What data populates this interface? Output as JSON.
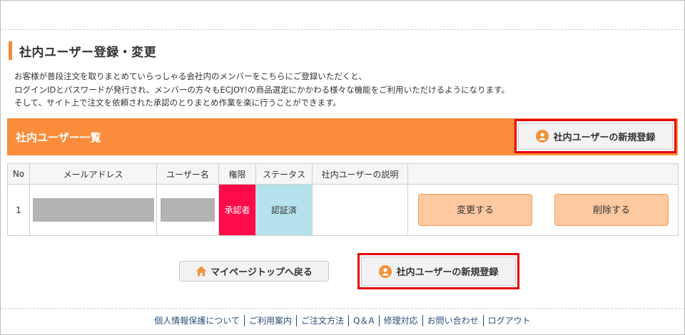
{
  "page": {
    "title": "社内ユーザー登録・変更",
    "intro": [
      "お客様が普段注文を取りまとめていらっしゃる会社内のメンバーをこちらにご登録いただくと、",
      "ログインIDとパスワードが発行され、メンバーの方々もECJOY!の商品選定にかかわる様々な機能をご利用いただけるようになります。",
      "そして、サイト上で注文を依頼された承認のとりまとめ作業を楽に行うことができます。"
    ]
  },
  "user_list": {
    "title": "社内ユーザー一覧",
    "new_button_label": "社内ユーザーの新規登録",
    "columns": {
      "no": "No",
      "email": "メールアドレス",
      "username": "ユーザー名",
      "permission": "権限",
      "status": "ステータス",
      "description": "社内ユーザーの説明"
    },
    "rows": [
      {
        "no": "1",
        "email": "",
        "username": "",
        "permission": "承認者",
        "status": "認証済",
        "description": "",
        "edit_label": "変更する",
        "delete_label": "削除する"
      }
    ]
  },
  "bottom": {
    "back_label": "マイページトップへ戻る",
    "new_button_label": "社内ユーザーの新規登録"
  },
  "footer": {
    "links": [
      "個人情報保護について",
      "ご利用案内",
      "ご注文方法",
      "Q＆A",
      "修理対応",
      "お問い合わせ",
      "ログアウト"
    ]
  },
  "colors": {
    "accent_orange": "#fb8c3c",
    "highlight_red": "#e3000b",
    "permission_bg": "#ff0a4a",
    "status_bg": "#b5e2ec",
    "action_button_bg": "#fec8a0",
    "footer_link": "#2b4f7a"
  },
  "icons": {
    "new_user": "user-circle-icon",
    "back": "home-icon"
  }
}
